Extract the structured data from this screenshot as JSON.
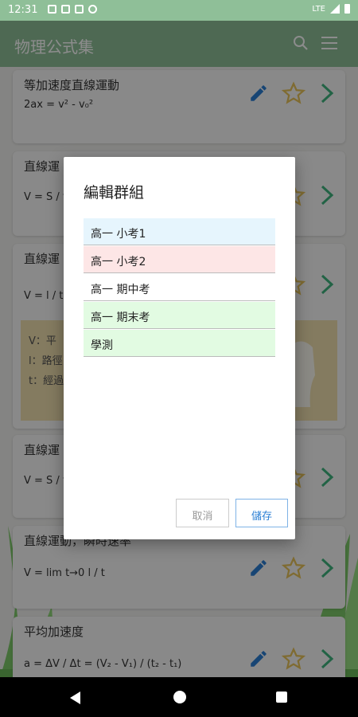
{
  "status_bar": {
    "time": "12:31",
    "network": "LTE"
  },
  "app_bar": {
    "title": "物理公式集",
    "icons": [
      "search-icon",
      "menu-icon"
    ]
  },
  "colors": {
    "primary": "#8fbf98",
    "accent_edit": "#2b7fd4",
    "accent_star": "#e8c45a",
    "accent_chevron": "#3fb47f"
  },
  "cards": [
    {
      "title": "等加速度直線運動",
      "formula": "2ax = v² - v₀²"
    },
    {
      "title": "直線運",
      "formula": "V = S / t ="
    },
    {
      "title": "直線運",
      "formula": "V = l / t"
    },
    {
      "title": "直線運",
      "formula": "V = S / t"
    },
    {
      "title": "直線運動，瞬時速率",
      "formula": "V = lim t→0  l / t"
    },
    {
      "title": "平均加速度",
      "formula": "a = ΔV / Δt = (V₂ - V₁) / (t₂ - t₁)"
    }
  ],
  "note": {
    "lines": [
      "V：平",
      "l：路徑",
      "t：經過"
    ]
  },
  "dialog": {
    "title": "編輯群組",
    "groups": [
      {
        "label": "高一 小考1",
        "color": "#e6f5fd"
      },
      {
        "label": "高一 小考2",
        "color": "#fde6e6"
      },
      {
        "label": "高一 期中考",
        "color": "#ffffff"
      },
      {
        "label": "高一 期末考",
        "color": "#e2fbe2"
      },
      {
        "label": "學測",
        "color": "#e2fbe2"
      }
    ],
    "cancel_label": "取消",
    "save_label": "儲存"
  }
}
